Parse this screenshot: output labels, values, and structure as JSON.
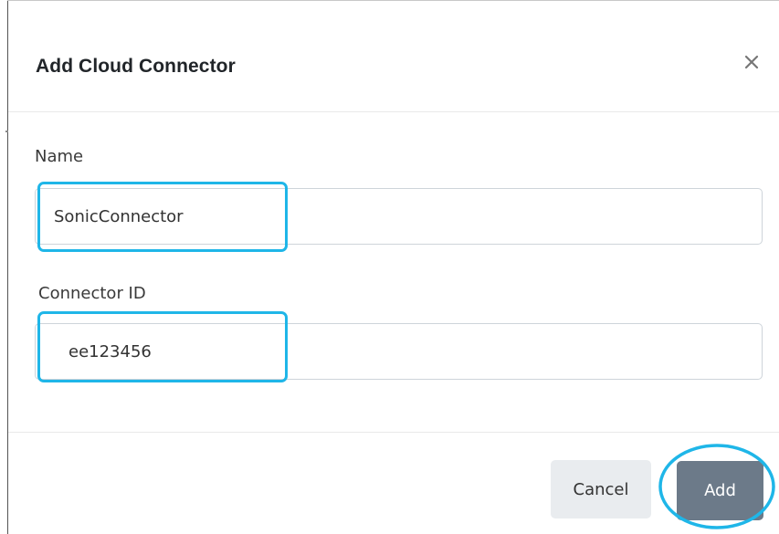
{
  "dialog": {
    "title": "Add Cloud Connector",
    "close_icon": "close-icon",
    "close_glyph": "×"
  },
  "form": {
    "name": {
      "label": "Name",
      "value": "SonicConnector"
    },
    "connector_id": {
      "label": "Connector ID",
      "value": "ee123456"
    }
  },
  "footer": {
    "cancel_label": "Cancel",
    "add_label": "Add"
  },
  "colors": {
    "highlight": "#1fb6e8",
    "add_button": "#6c7a89",
    "cancel_button": "#e9ecef"
  }
}
